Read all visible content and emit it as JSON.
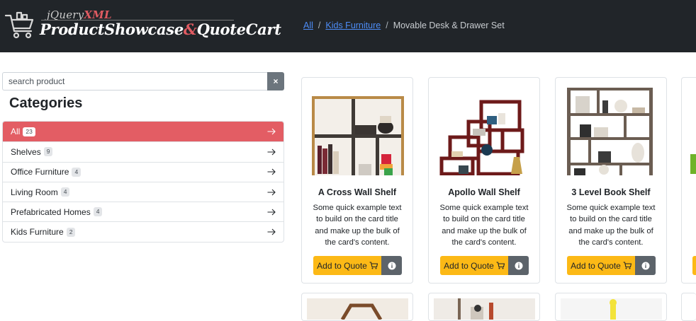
{
  "header": {
    "logo_small": "jQuery",
    "logo_small_accent": "XML",
    "logo_main_1": "ProductShowcase",
    "logo_main_amp": "&",
    "logo_main_2": "QuoteCart"
  },
  "breadcrumb": {
    "items": [
      "All",
      "Kids Furniture"
    ],
    "separator": "/",
    "current": "Movable Desk & Drawer Set"
  },
  "search": {
    "placeholder": "search product",
    "clear_label": "×"
  },
  "categories": {
    "title": "Categories",
    "items": [
      {
        "label": "All",
        "count": "23"
      },
      {
        "label": "Shelves",
        "count": "9"
      },
      {
        "label": "Office Furniture",
        "count": "4"
      },
      {
        "label": "Living Room",
        "count": "4"
      },
      {
        "label": "Prefabricated Homes",
        "count": "4"
      },
      {
        "label": "Kids Furniture",
        "count": "2"
      }
    ],
    "active_color": "#e35d64"
  },
  "products": [
    {
      "title": "A Cross Wall Shelf",
      "text": "Some quick example text to build on the card title and make up the bulk of the card's content.",
      "button": "Add to Quote"
    },
    {
      "title": "Apollo Wall Shelf",
      "text": "Some quick example text to build on the card title and make up the bulk of the card's content.",
      "button": "Add to Quote"
    },
    {
      "title": "3 Level Book Shelf",
      "text": "Some quick example text to build on the card title and make up the bulk of the card's content.",
      "button": "Add to Quote"
    }
  ],
  "colors": {
    "header_bg": "#212529",
    "accent": "#e35d64",
    "quote_button": "#fcb916",
    "info_button": "#5c636a",
    "link": "#4d8df7"
  },
  "icons": [
    "cart-logo-icon",
    "arrow-right-icon",
    "cart-icon",
    "info-icon"
  ]
}
